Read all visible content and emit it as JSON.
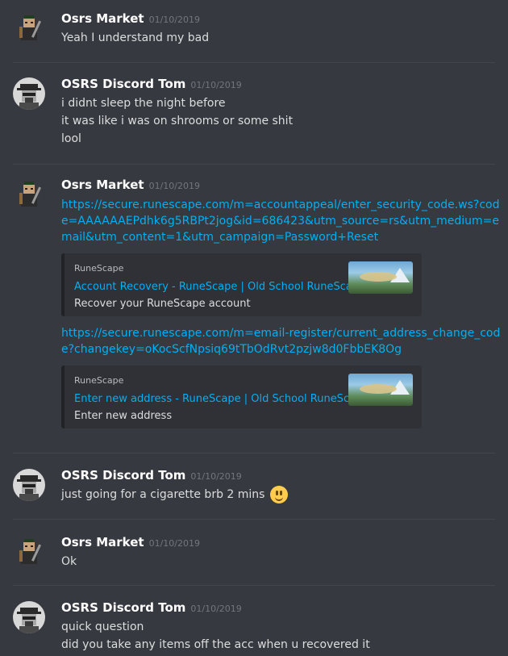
{
  "messages": [
    {
      "author": "Osrs Market",
      "timestamp": "01/10/2019",
      "lines": [
        "Yeah I understand my bad"
      ]
    },
    {
      "author": "OSRS Discord Tom",
      "timestamp": "01/10/2019",
      "lines": [
        "i didnt sleep the night before",
        "it was like i was on shrooms or some shit",
        "lool"
      ]
    },
    {
      "author": "Osrs Market",
      "timestamp": "01/10/2019",
      "link1": "https://secure.runescape.com/m=accountappeal/enter_security_code.ws?code=AAAAAAEPdhk6g5RBPt2jog&id=686423&utm_source=rs&utm_medium=email&utm_content=1&utm_campaign=Password+Reset",
      "embed1": {
        "provider": "RuneScape",
        "title": "Account Recovery - RuneScape | Old School RuneScape",
        "description": "Recover your RuneScape account"
      },
      "link2": "https://secure.runescape.com/m=email-register/current_address_change_code?changekey=oKocScfNpsiq69tTbOdRvt2pzjw8d0FbbEK8Og",
      "embed2": {
        "provider": "RuneScape",
        "title": "Enter new address - RuneScape | Old School RuneScape",
        "description": "Enter new address"
      }
    },
    {
      "author": "OSRS Discord Tom",
      "timestamp": "01/10/2019",
      "lines": [
        "just going for a cigarette brb 2 mins"
      ]
    },
    {
      "author": "Osrs Market",
      "timestamp": "01/10/2019",
      "lines": [
        "Ok"
      ]
    },
    {
      "author": "OSRS Discord Tom",
      "timestamp": "01/10/2019",
      "lines": [
        "quick question",
        "did you take any items off the acc when u recovered it"
      ]
    }
  ],
  "colors": {
    "background": "#36393f",
    "link": "#00b0f4",
    "author": "#ffffff",
    "timestamp": "#72767d"
  },
  "icons": {
    "market_avatar": "pixel-character-avatar-icon",
    "tom_avatar": "heisenberg-avatar-icon",
    "emoji": "smiley-emoji-icon"
  }
}
